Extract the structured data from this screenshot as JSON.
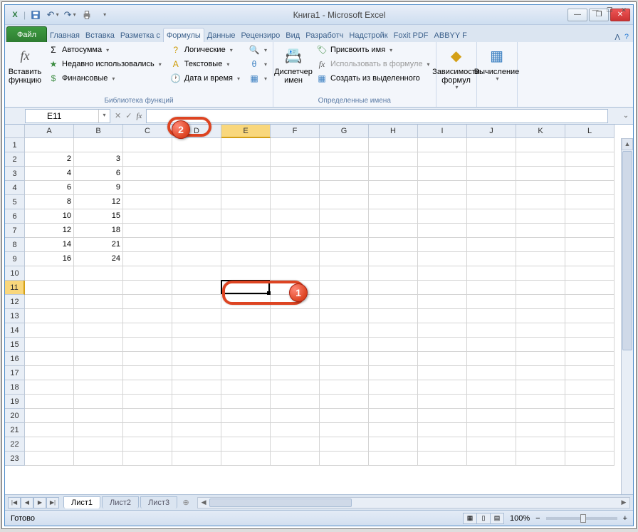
{
  "title": "Книга1 - Microsoft Excel",
  "tabs": {
    "file": "Файл",
    "home": "Главная",
    "insert": "Вставка",
    "layout": "Разметка с",
    "formulas": "Формулы",
    "data": "Данные",
    "review": "Рецензиро",
    "view": "Вид",
    "dev": "Разработч",
    "addins": "Надстройк",
    "foxit": "Foxit PDF",
    "abbyy": "ABBYY F"
  },
  "ribbon": {
    "insert_fn": "Вставить функцию",
    "autosum": "Автосумма",
    "recent": "Недавно использовались",
    "financial": "Финансовые",
    "library_label": "Библиотека функций",
    "logical": "Логические",
    "text": "Текстовые",
    "date": "Дата и время",
    "name_mgr": "Диспетчер имен",
    "assign": "Присвоить имя",
    "use_in": "Использовать в формуле",
    "create_from": "Создать из выделенного",
    "names_label": "Определенные имена",
    "deps": "Зависимости формул",
    "calc": "Вычисление"
  },
  "name_box": "E11",
  "columns": [
    "A",
    "B",
    "C",
    "D",
    "E",
    "F",
    "G",
    "H",
    "I",
    "J",
    "K",
    "L"
  ],
  "rows": [
    "1",
    "2",
    "3",
    "4",
    "5",
    "6",
    "7",
    "8",
    "9",
    "10",
    "11",
    "12",
    "13",
    "14",
    "15",
    "16",
    "17",
    "18",
    "19",
    "20",
    "21",
    "22",
    "23"
  ],
  "cells": {
    "A2": "2",
    "B2": "3",
    "A3": "4",
    "B3": "6",
    "A4": "6",
    "B4": "9",
    "A5": "8",
    "B5": "12",
    "A6": "10",
    "B6": "15",
    "A7": "12",
    "B7": "18",
    "A8": "14",
    "B8": "21",
    "A9": "16",
    "B9": "24"
  },
  "active_col": "E",
  "active_row": "11",
  "sheets": {
    "s1": "Лист1",
    "s2": "Лист2",
    "s3": "Лист3"
  },
  "status": "Готово",
  "zoom": "100%",
  "callouts": {
    "b1": "1",
    "b2": "2"
  }
}
